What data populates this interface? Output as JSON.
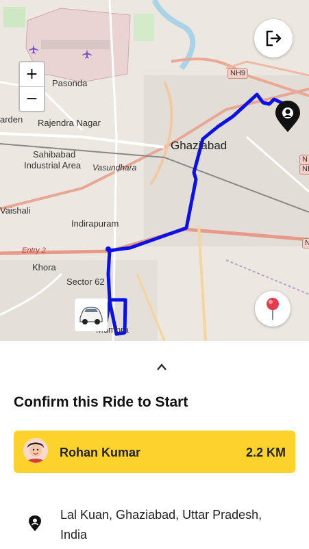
{
  "map": {
    "zoom_in_label": "+",
    "zoom_out_label": "−",
    "place_labels": {
      "pasonda": "Pasonda",
      "rajendra_nagar": "Rajendra Nagar",
      "arden": "arden",
      "ghaziabad": "Ghaziabad",
      "sahibabad": "Sahibabad",
      "industrial_area": "Industrial Area",
      "vasundhara": "Vasundhara",
      "vaishali": "Vaishali",
      "indirapuram": "Indirapuram",
      "entry2": "Entry 2",
      "khora": "Khora",
      "sector62": "Sector 62",
      "mumbra": "Mumbra",
      "nh9": "NH9",
      "n_right": "N",
      "nh_right": "NH",
      "n_right2": "N"
    },
    "exit_icon": "logout-icon",
    "location_pin_icon": "red-pushpin-icon",
    "destination_marker_icon": "map-pin-icon",
    "car_icon": "car-icon",
    "route_color": "#0a10e6"
  },
  "panel": {
    "expand_icon": "chevron-up-icon",
    "title": "Confirm this Ride to Start",
    "driver": {
      "name": "Rohan Kumar",
      "distance": "2.2 KM",
      "card_color": "#fdd22c"
    },
    "destination": {
      "icon": "location-pin-icon",
      "address": "Lal Kuan, Ghaziabad, Uttar Pradesh, India"
    }
  }
}
